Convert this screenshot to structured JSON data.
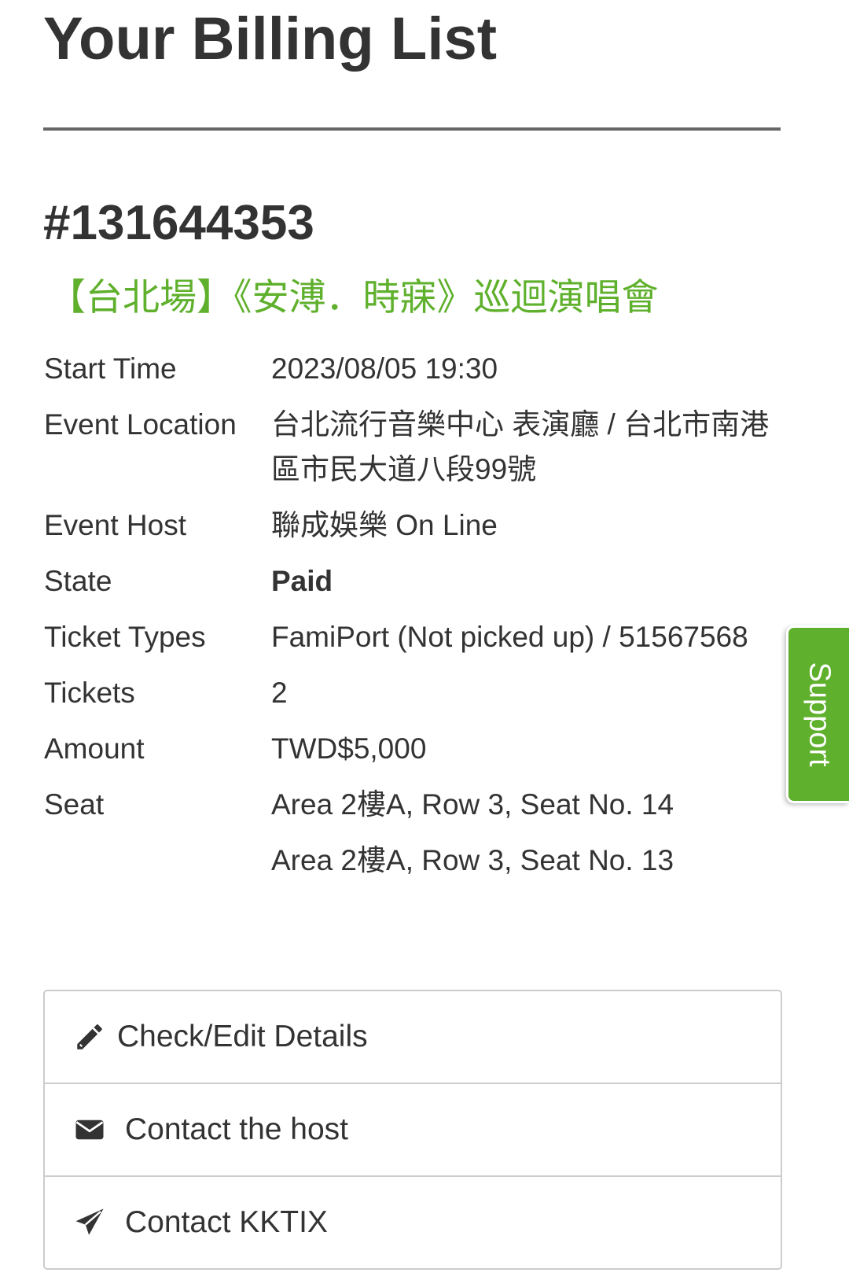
{
  "page": {
    "title": "Your Billing List"
  },
  "order": {
    "number": "#131644353",
    "event_title": "【台北場】《安溥．時寐》巡迴演唱會",
    "accent_color": "#5fb02c"
  },
  "details": {
    "start_time": {
      "label": "Start Time",
      "value": "2023/08/05 19:30"
    },
    "location": {
      "label": "Event Location",
      "value": "台北流行音樂中心 表演廳 / 台北市南港區市民大道八段99號"
    },
    "host": {
      "label": "Event Host",
      "value": "聯成娛樂 On Line"
    },
    "state": {
      "label": "State",
      "value": "Paid"
    },
    "ticket_types": {
      "label": "Ticket Types",
      "value": "FamiPort (Not picked up) / 51567568"
    },
    "tickets": {
      "label": "Tickets",
      "value": "2"
    },
    "amount": {
      "label": "Amount",
      "value": "TWD$5,000"
    },
    "seat": {
      "label": "Seat",
      "values": [
        "Area 2樓A, Row 3, Seat No. 14",
        "Area 2樓A, Row 3, Seat No. 13"
      ]
    }
  },
  "actions": {
    "edit": {
      "label": "Check/Edit Details",
      "icon": "pencil-icon"
    },
    "contact_host": {
      "label": "Contact the host",
      "icon": "envelope-icon"
    },
    "contact_kktix": {
      "label": "Contact KKTIX",
      "icon": "paper-plane-icon"
    }
  },
  "support": {
    "label": "Support",
    "color": "#5fb02c"
  }
}
